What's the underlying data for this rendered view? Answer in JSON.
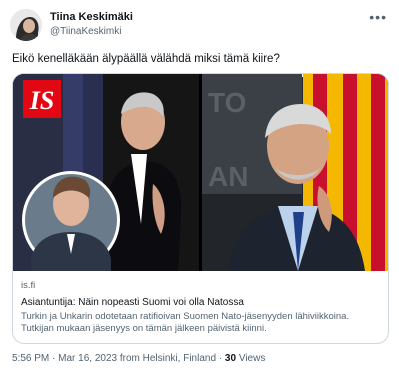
{
  "author": {
    "name": "Tiina Keskimäki",
    "handle": "@TiinaKeskimki"
  },
  "tweet": {
    "text": "Eikö kenelläkään älypäällä välähdä miksi tämä kiire?"
  },
  "card": {
    "logo_text": "IS",
    "domain": "is.fi",
    "title": "Asiantuntija: Näin nopeasti Suomi voi olla Natossa",
    "description": "Turkin ja Unkarin odotetaan ratifioivan Suomen Nato-jäsenyyden lähiviikkoina. Tutkijan mukaan jäsenyys on tämän jälkeen päivistä kiinni."
  },
  "meta": {
    "time": "5:56 PM",
    "separator1": "·",
    "date": "Mar 16, 2023 from Helsinki, Finland",
    "separator2": "·",
    "views_count": "30",
    "views_label": "Views"
  },
  "icons": {
    "more": "more-options-icon"
  },
  "colors": {
    "logo_red": "#e30613",
    "text_primary": "#0f1419",
    "text_secondary": "#536471",
    "border": "#cfd9de",
    "flag_yellow": "#f5b800",
    "flag_red": "#c8102e"
  }
}
